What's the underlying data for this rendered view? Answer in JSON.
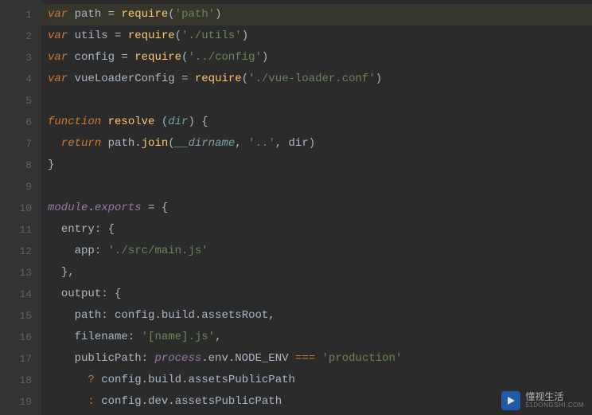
{
  "total_lines": 19,
  "highlighted_line": 1,
  "lines": {
    "l1": {
      "var": "var",
      "path": "path",
      "eq": " = ",
      "require": "require",
      "lp": "(",
      "s": "'path'",
      "rp": ")"
    },
    "l2": {
      "var": "var",
      "utils": "utils",
      "eq": " = ",
      "require": "require",
      "lp": "(",
      "s": "'./utils'",
      "rp": ")"
    },
    "l3": {
      "var": "var",
      "config": "config",
      "eq": " = ",
      "require": "require",
      "lp": "(",
      "s": "'../config'",
      "rp": ")"
    },
    "l4": {
      "var": "var",
      "vlc": "vueLoaderConfig",
      "eq": " = ",
      "require": "require",
      "lp": "(",
      "s": "'./vue-loader.conf'",
      "rp": ")"
    },
    "l6": {
      "function": "function",
      "sp": " ",
      "resolve": "resolve",
      "spc": " ",
      "lp": "(",
      "dir": "dir",
      "rp": ")",
      "spc2": " ",
      "lb": "{"
    },
    "l7": {
      "return": "return",
      "sp": " ",
      "path": "path",
      "dot": ".",
      "join": "join",
      "lp": "(",
      "dirname": "__dirname",
      "c1": ", ",
      "s": "'..'",
      "c2": ", ",
      "dir": "dir",
      "rp": ")"
    },
    "l8": {
      "rb": "}"
    },
    "l10": {
      "module": "module",
      "dot": ".",
      "exports": "exports",
      "eq": " = ",
      "lb": "{"
    },
    "l11": {
      "entry": "entry",
      "colon": ": ",
      "lb": "{"
    },
    "l12": {
      "app": "app",
      "colon": ": ",
      "s": "'./src/main.js'"
    },
    "l13": {
      "rb": "}",
      "comma": ","
    },
    "l14": {
      "output": "output",
      "colon": ": ",
      "lb": "{"
    },
    "l15": {
      "path": "path",
      "colon": ": ",
      "config": "config",
      "d1": ".",
      "build": "build",
      "d2": ".",
      "assetsRoot": "assetsRoot",
      "comma": ","
    },
    "l16": {
      "filename": "filename",
      "colon": ": ",
      "s": "'[name].js'",
      "comma": ","
    },
    "l17": {
      "publicPath": "publicPath",
      "colon": ": ",
      "process": "process",
      "d1": ".",
      "env": "env",
      "d2": ".",
      "node": "NODE_ENV",
      "sp": " ",
      "cmp": "===",
      "sp2": " ",
      "s": "'production'"
    },
    "l18": {
      "q": "?",
      "sp": " ",
      "config": "config",
      "d1": ".",
      "build": "build",
      "d2": ".",
      "apb": "assetsPublicPath"
    },
    "l19": {
      "c": ":",
      "sp": " ",
      "config": "config",
      "d1": ".",
      "dev": "dev",
      "d2": ".",
      "apb": "assetsPublicPath"
    }
  },
  "watermark": {
    "title": "懂视生活",
    "sub": "51DONGSHI.COM"
  }
}
